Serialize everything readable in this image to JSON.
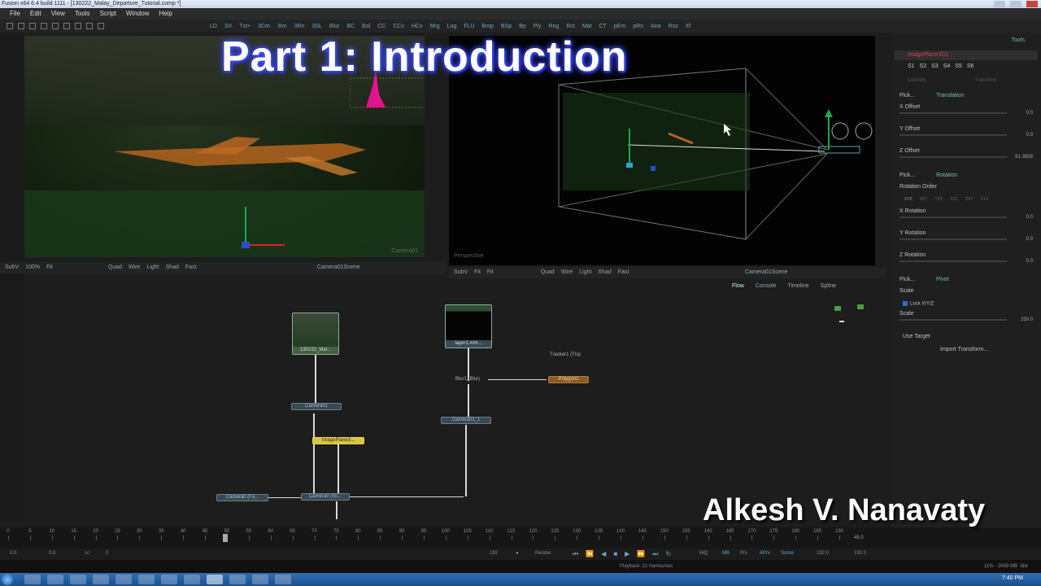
{
  "window": {
    "title": "Fusion x64 6.4 build 1111 - [130222_Malay_Departure_Tutorial.comp *]"
  },
  "menu": [
    "File",
    "Edit",
    "View",
    "Tools",
    "Script",
    "Window",
    "Help"
  ],
  "toolbar_tools": [
    "LD",
    "SV",
    "Txt+",
    "3Cm",
    "3Im",
    "3Rn",
    "3SL",
    "Blur",
    "BC",
    "Bol",
    "CC",
    "CCv",
    "HCv",
    "Mrg",
    "Log",
    "FLU",
    "Bmp",
    "BSp",
    "Bp",
    "Ply",
    "Rng",
    "Rct",
    "Mat",
    "CT",
    "pEm",
    "pRn",
    "Ana",
    "Rsz",
    "Xf"
  ],
  "overlay": {
    "title": "Part 1: Introduction",
    "author": "Alkesh V. Nanavaty"
  },
  "viewer_left": {
    "label": "Camera01",
    "controls": [
      "SubV",
      "100%",
      "Fit",
      "Quad",
      "Wire",
      "Light",
      "Shad",
      "Fast"
    ],
    "scene": "Camera01Scene"
  },
  "viewer_right": {
    "label": "Perspective",
    "controls": [
      "SubV",
      "Fit",
      "Fit",
      "Quad",
      "Wire",
      "Light",
      "Shad",
      "Fast"
    ],
    "scene": "Camera01Scene"
  },
  "inspector": {
    "tabs": "Tools",
    "node_name": "ImagePlane3D1",
    "frames": [
      "S1",
      "S2",
      "S3",
      "S4",
      "S5",
      "S6"
    ],
    "subtabs": [
      "Controls",
      "Transform"
    ],
    "translation_header": "Translation",
    "pick": "Pick...",
    "rows": [
      {
        "label": "X Offset",
        "value": "0.0"
      },
      {
        "label": "Y Offset",
        "value": "0.0"
      },
      {
        "label": "Z Offset",
        "value": "61.3858"
      }
    ],
    "rotation_header": "Rotation",
    "rotation_order_label": "Rotation Order",
    "rotation_order": [
      "XYZ",
      "XZY",
      "YXZ",
      "YZX",
      "ZXY",
      "ZYX"
    ],
    "rotation_rows": [
      {
        "label": "X Rotation",
        "value": "0.0"
      },
      {
        "label": "Y Rotation",
        "value": "0.0"
      },
      {
        "label": "Z Rotation",
        "value": "0.0"
      }
    ],
    "pivot_header": "Pivot",
    "scale_header": "Scale",
    "lock_xyz": "Lock X/Y/Z",
    "scale_label": "Scale",
    "scale_value": "250.0",
    "use_target": "Use Target",
    "import_transform": "Import Transform..."
  },
  "flow_tabs": [
    "Flow",
    "Console",
    "Timeline",
    "Spline"
  ],
  "nodes": {
    "loader": "130222_Mal...",
    "layer": "layer1.###...",
    "camera01": "Camera01",
    "imageplane": "ImagePlane3...",
    "tracker": "Tracker1 (Tra)",
    "blur": "Blur1 (Blur)",
    "polygon": "Polygon1",
    "camera01_1": "Camera01_1",
    "camera0_fa": "Camera0 (Fa...",
    "scene": "Camera0 (Sc..."
  },
  "timeline": {
    "ticks": [
      "0",
      "5",
      "10",
      "15",
      "20",
      "25",
      "30",
      "35",
      "40",
      "45",
      "50",
      "55",
      "60",
      "65",
      "70",
      "75",
      "80",
      "85",
      "90",
      "95",
      "100",
      "105",
      "110",
      "115",
      "120",
      "125",
      "130",
      "135",
      "140",
      "145",
      "150",
      "155",
      "160",
      "165",
      "170",
      "175",
      "180",
      "185",
      "190"
    ],
    "end_label": "45.0"
  },
  "transport": {
    "start": "0.0",
    "start2": "0.0",
    "cc": "cc",
    "current": "0",
    "end_frames": "192",
    "render": "Render",
    "hiq": "HiQ",
    "mb": "MB",
    "prx": "Prx",
    "aprx": "APrx",
    "some": "Some",
    "range_end": "192.0",
    "global_end": "192.0"
  },
  "status": {
    "playback": "Playback: 21 frames/sec",
    "memory": "11% - 2659 MB",
    "state": "Idle"
  },
  "taskbar": {
    "clock": "7:40 PM"
  }
}
